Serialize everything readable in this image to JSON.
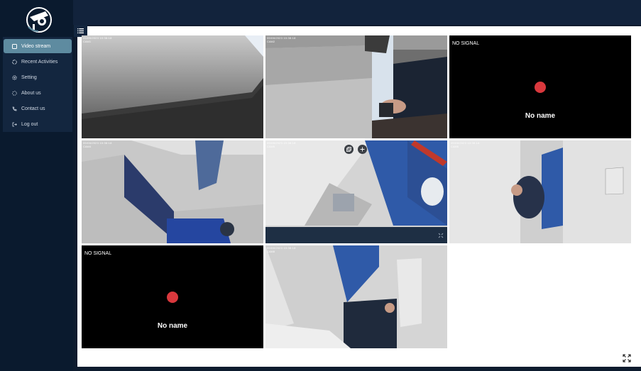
{
  "sidebar": {
    "logo": "security-camera-logo",
    "items": [
      {
        "label": "Video stream",
        "icon": "square-icon",
        "active": true
      },
      {
        "label": "Recent Activities",
        "icon": "refresh-icon",
        "active": false
      },
      {
        "label": "Setting",
        "icon": "gear-icon",
        "active": false
      },
      {
        "label": "About us",
        "icon": "circle-dashed-icon",
        "active": false
      },
      {
        "label": "Contact us",
        "icon": "phone-icon",
        "active": false
      },
      {
        "label": "Log out",
        "icon": "logout-icon",
        "active": false
      }
    ]
  },
  "grid": {
    "tiles": [
      {
        "type": "video",
        "timestamp": "05/06/2023 10:38:18",
        "cam": "CAM1"
      },
      {
        "type": "video",
        "timestamp": "05/06/2023 10:38:18",
        "cam": "CAM2"
      },
      {
        "type": "no_signal",
        "status": "NO SIGNAL",
        "name": "No name"
      },
      {
        "type": "video",
        "timestamp": "05/06/2023 10:38:18",
        "cam": "CAM4"
      },
      {
        "type": "video",
        "timestamp": "05/06/2023 10:38:18",
        "cam": "CAM5",
        "hovered": true
      },
      {
        "type": "video",
        "timestamp": "05/06/2023 10:38:18",
        "cam": "CAM6"
      },
      {
        "type": "no_signal",
        "status": "NO SIGNAL",
        "name": "No name"
      },
      {
        "type": "video",
        "timestamp": "05/06/2023 10:38:18",
        "cam": "CAM8"
      }
    ]
  },
  "icons": {
    "menu": "hamburger-icon",
    "fullscreen": "expand-icon",
    "tile_popout": "popout-icon",
    "tile_move": "move-icon",
    "tile_fullscreen": "collapse-icon"
  },
  "colors": {
    "sidebar_bg": "#0a1a2e",
    "active_item": "#5e8ba0",
    "record_dot": "#d9383d"
  }
}
